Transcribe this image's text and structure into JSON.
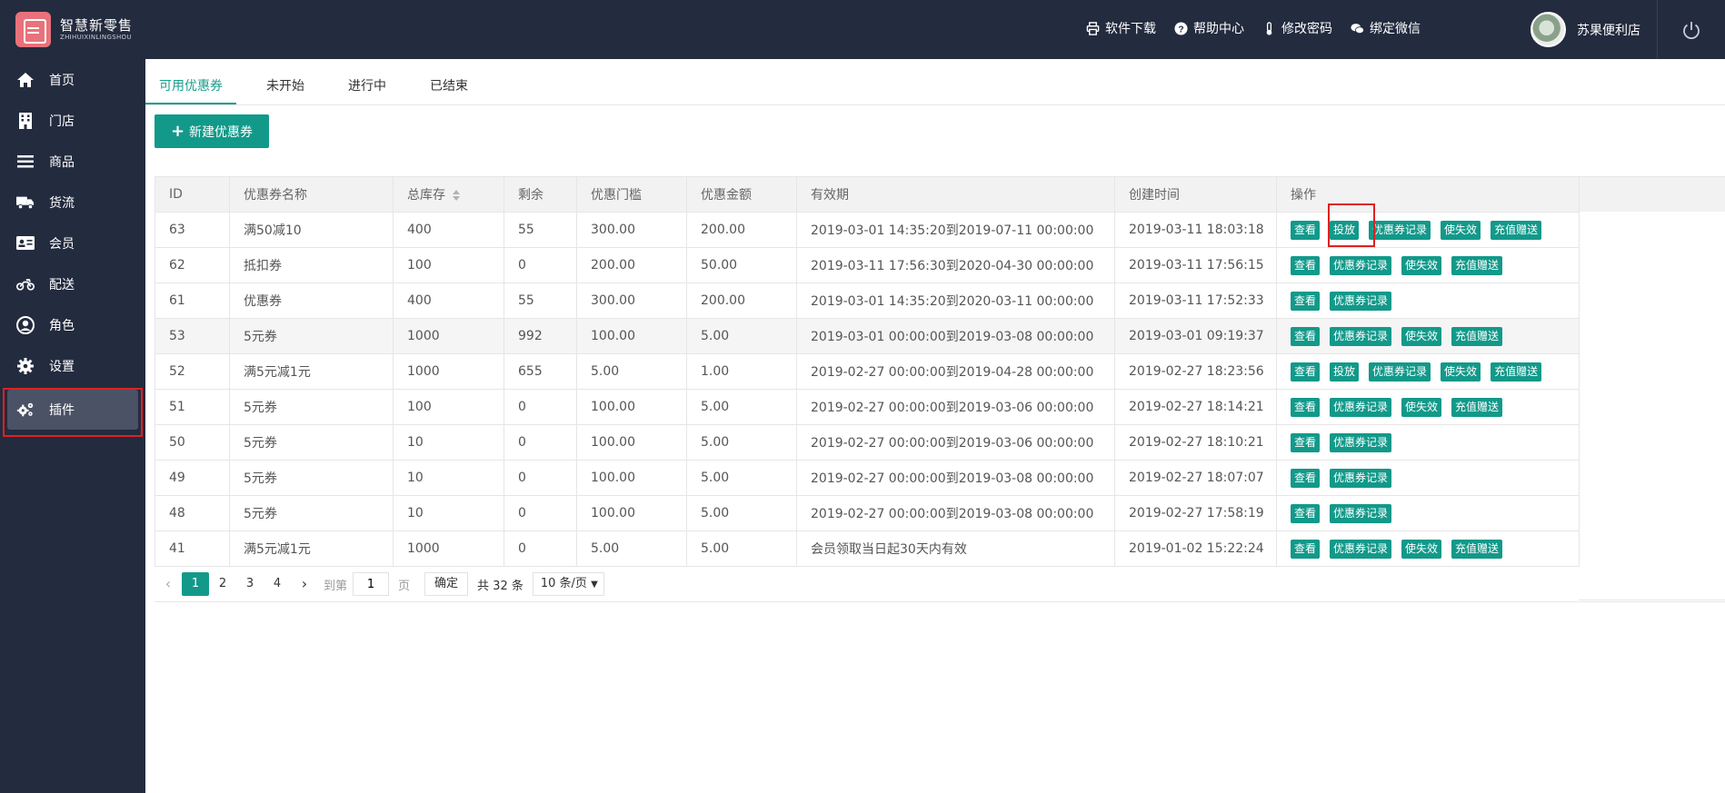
{
  "header": {
    "logo_cn": "智慧新零售",
    "logo_en": "ZHIHUIXINLINGSHOU",
    "links": [
      {
        "label": "软件下载",
        "icon": "printer-icon"
      },
      {
        "label": "帮助中心",
        "icon": "help-icon"
      },
      {
        "label": "修改密码",
        "icon": "thermometer-icon"
      },
      {
        "label": "绑定微信",
        "icon": "wechat-icon"
      }
    ],
    "user_name": "苏果便利店"
  },
  "sidebar": {
    "items": [
      {
        "label": "首页",
        "icon": "home-icon"
      },
      {
        "label": "门店",
        "icon": "building-icon"
      },
      {
        "label": "商品",
        "icon": "list-icon"
      },
      {
        "label": "货流",
        "icon": "truck-icon"
      },
      {
        "label": "会员",
        "icon": "member-card-icon"
      },
      {
        "label": "配送",
        "icon": "motorcycle-icon"
      },
      {
        "label": "角色",
        "icon": "user-circle-icon"
      },
      {
        "label": "设置",
        "icon": "gear-icon"
      },
      {
        "label": "插件",
        "icon": "gears-icon"
      }
    ],
    "active_index": 8
  },
  "tabs": [
    "可用优惠券",
    "未开始",
    "进行中",
    "已结束"
  ],
  "new_button": "新建优惠券",
  "table": {
    "columns": [
      "ID",
      "优惠券名称",
      "总库存",
      "剩余",
      "优惠门槛",
      "优惠金额",
      "有效期",
      "创建时间",
      "操作"
    ],
    "rows": [
      {
        "id": "63",
        "name": "满50减10",
        "stock": "400",
        "left": "55",
        "threshold": "300.00",
        "amount": "200.00",
        "period": "2019-03-01 14:35:20到2019-07-11 00:00:00",
        "created": "2019-03-11 18:03:18",
        "actions": [
          "查看",
          "投放",
          "优惠券记录",
          "使失效",
          "充值赠送"
        ]
      },
      {
        "id": "62",
        "name": "抵扣券",
        "stock": "100",
        "left": "0",
        "threshold": "200.00",
        "amount": "50.00",
        "period": "2019-03-11 17:56:30到2020-04-30 00:00:00",
        "created": "2019-03-11 17:56:15",
        "actions": [
          "查看",
          "优惠券记录",
          "使失效",
          "充值赠送"
        ]
      },
      {
        "id": "61",
        "name": "优惠券",
        "stock": "400",
        "left": "55",
        "threshold": "300.00",
        "amount": "200.00",
        "period": "2019-03-01 14:35:20到2020-03-11 00:00:00",
        "created": "2019-03-11 17:52:33",
        "actions": [
          "查看",
          "优惠券记录"
        ]
      },
      {
        "id": "53",
        "name": "5元券",
        "stock": "1000",
        "left": "992",
        "threshold": "100.00",
        "amount": "5.00",
        "period": "2019-03-01 00:00:00到2019-03-08 00:00:00",
        "created": "2019-03-01 09:19:37",
        "actions": [
          "查看",
          "优惠券记录",
          "使失效",
          "充值赠送"
        ]
      },
      {
        "id": "52",
        "name": "满5元减1元",
        "stock": "1000",
        "left": "655",
        "threshold": "5.00",
        "amount": "1.00",
        "period": "2019-02-27 00:00:00到2019-04-28 00:00:00",
        "created": "2019-02-27 18:23:56",
        "actions": [
          "查看",
          "投放",
          "优惠券记录",
          "使失效",
          "充值赠送"
        ]
      },
      {
        "id": "51",
        "name": "5元券",
        "stock": "100",
        "left": "0",
        "threshold": "100.00",
        "amount": "5.00",
        "period": "2019-02-27 00:00:00到2019-03-06 00:00:00",
        "created": "2019-02-27 18:14:21",
        "actions": [
          "查看",
          "优惠券记录",
          "使失效",
          "充值赠送"
        ]
      },
      {
        "id": "50",
        "name": "5元券",
        "stock": "10",
        "left": "0",
        "threshold": "100.00",
        "amount": "5.00",
        "period": "2019-02-27 00:00:00到2019-03-06 00:00:00",
        "created": "2019-02-27 18:10:21",
        "actions": [
          "查看",
          "优惠券记录"
        ]
      },
      {
        "id": "49",
        "name": "5元券",
        "stock": "10",
        "left": "0",
        "threshold": "100.00",
        "amount": "5.00",
        "period": "2019-02-27 00:00:00到2019-03-08 00:00:00",
        "created": "2019-02-27 18:07:07",
        "actions": [
          "查看",
          "优惠券记录"
        ]
      },
      {
        "id": "48",
        "name": "5元券",
        "stock": "10",
        "left": "0",
        "threshold": "100.00",
        "amount": "5.00",
        "period": "2019-02-27 00:00:00到2019-03-08 00:00:00",
        "created": "2019-02-27 17:58:19",
        "actions": [
          "查看",
          "优惠券记录"
        ]
      },
      {
        "id": "41",
        "name": "满5元减1元",
        "stock": "1000",
        "left": "0",
        "threshold": "5.00",
        "amount": "5.00",
        "period": "会员领取当日起30天内有效",
        "created": "2019-01-02 15:22:24",
        "actions": [
          "查看",
          "优惠券记录",
          "使失效",
          "充值赠送"
        ]
      }
    ]
  },
  "pager": {
    "pages": [
      "1",
      "2",
      "3",
      "4"
    ],
    "current": "1",
    "goto_label": "到第",
    "goto_value": "1",
    "page_unit": "页",
    "confirm": "确定",
    "total": "共 32 条",
    "page_size": "10 条/页"
  },
  "colors": {
    "sidebar_bg": "#232b3e",
    "accent": "#12998a",
    "highlight": "#e02020"
  }
}
